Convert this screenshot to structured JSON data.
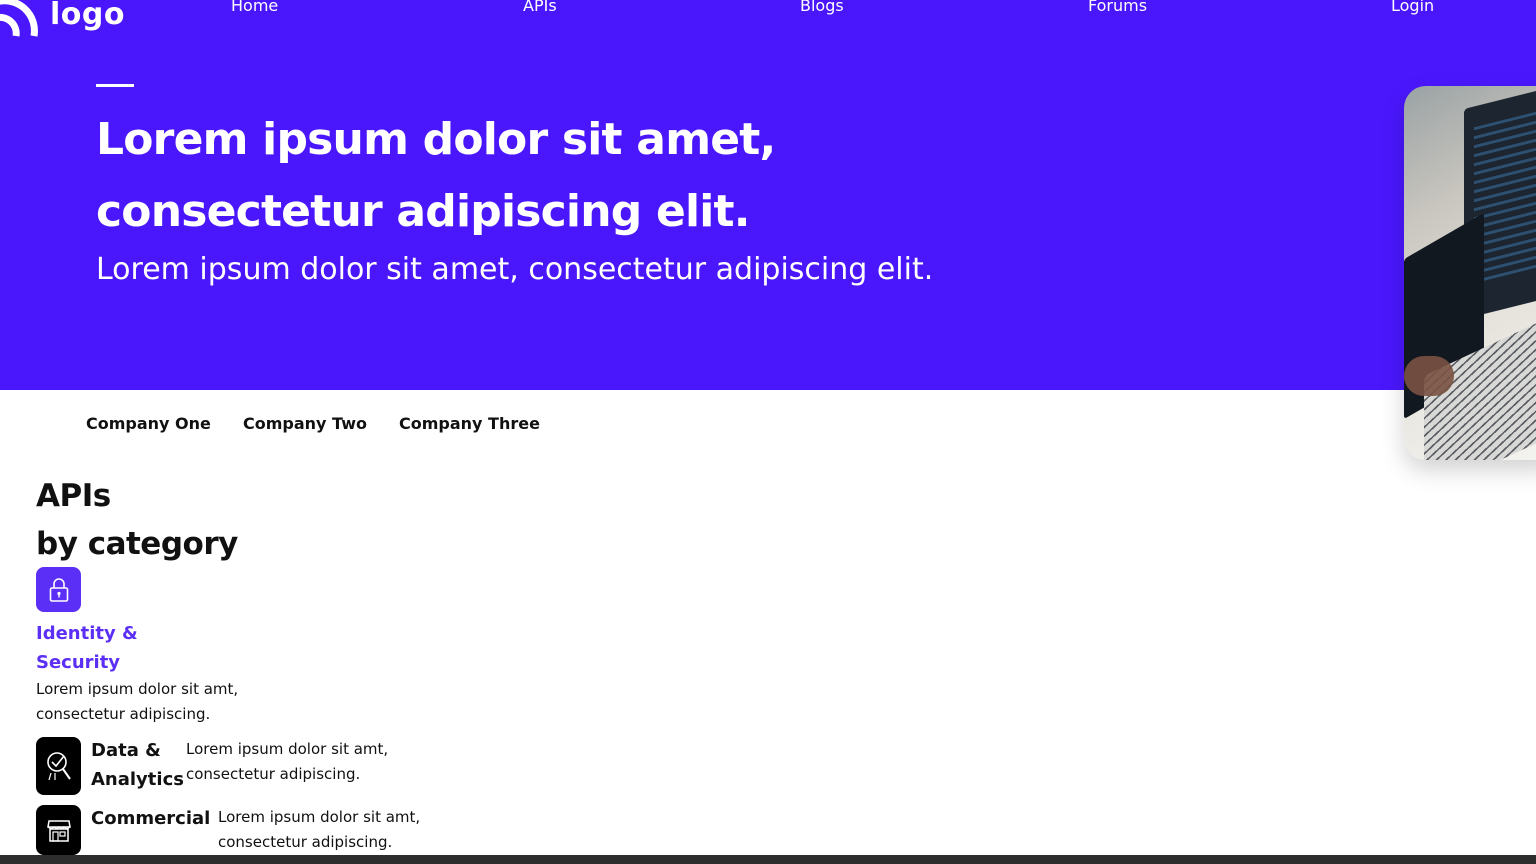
{
  "header": {
    "logo_text": "logo",
    "nav": [
      {
        "label": "Home"
      },
      {
        "label": "APIs"
      },
      {
        "label": "Blogs"
      },
      {
        "label": "Forums"
      },
      {
        "label": "Login"
      }
    ]
  },
  "hero": {
    "title_line1": "Lorem ipsum dolor sit amet,",
    "title_line2": "consectetur adipiscing elit.",
    "subtitle": "Lorem ipsum dolor sit amet, consectetur adipiscing elit.",
    "background_color": "#4a17fd"
  },
  "companies": [
    "Company One",
    "Company Two",
    "Company Three"
  ],
  "apis_section": {
    "title_line1": "APIs",
    "title_line2": "by category",
    "categories": [
      {
        "title_line1": "Identity &",
        "title_line2": "Security",
        "desc_line1": "Lorem ipsum dolor sit amt,",
        "desc_line2": "consectetur adipiscing.",
        "icon": "lock-icon",
        "accent_color": "#5b2ff5"
      },
      {
        "title_line1": "Data &",
        "title_line2": "Analytics",
        "desc_line1": "Lorem ipsum dolor sit amt,",
        "desc_line2": "consectetur adipiscing.",
        "icon": "analytics-search-icon"
      },
      {
        "title_line1": "Commercial",
        "desc_line1": "Lorem ipsum dolor sit amt,",
        "desc_line2": "consectetur adipiscing.",
        "icon": "storefront-icon"
      }
    ]
  }
}
